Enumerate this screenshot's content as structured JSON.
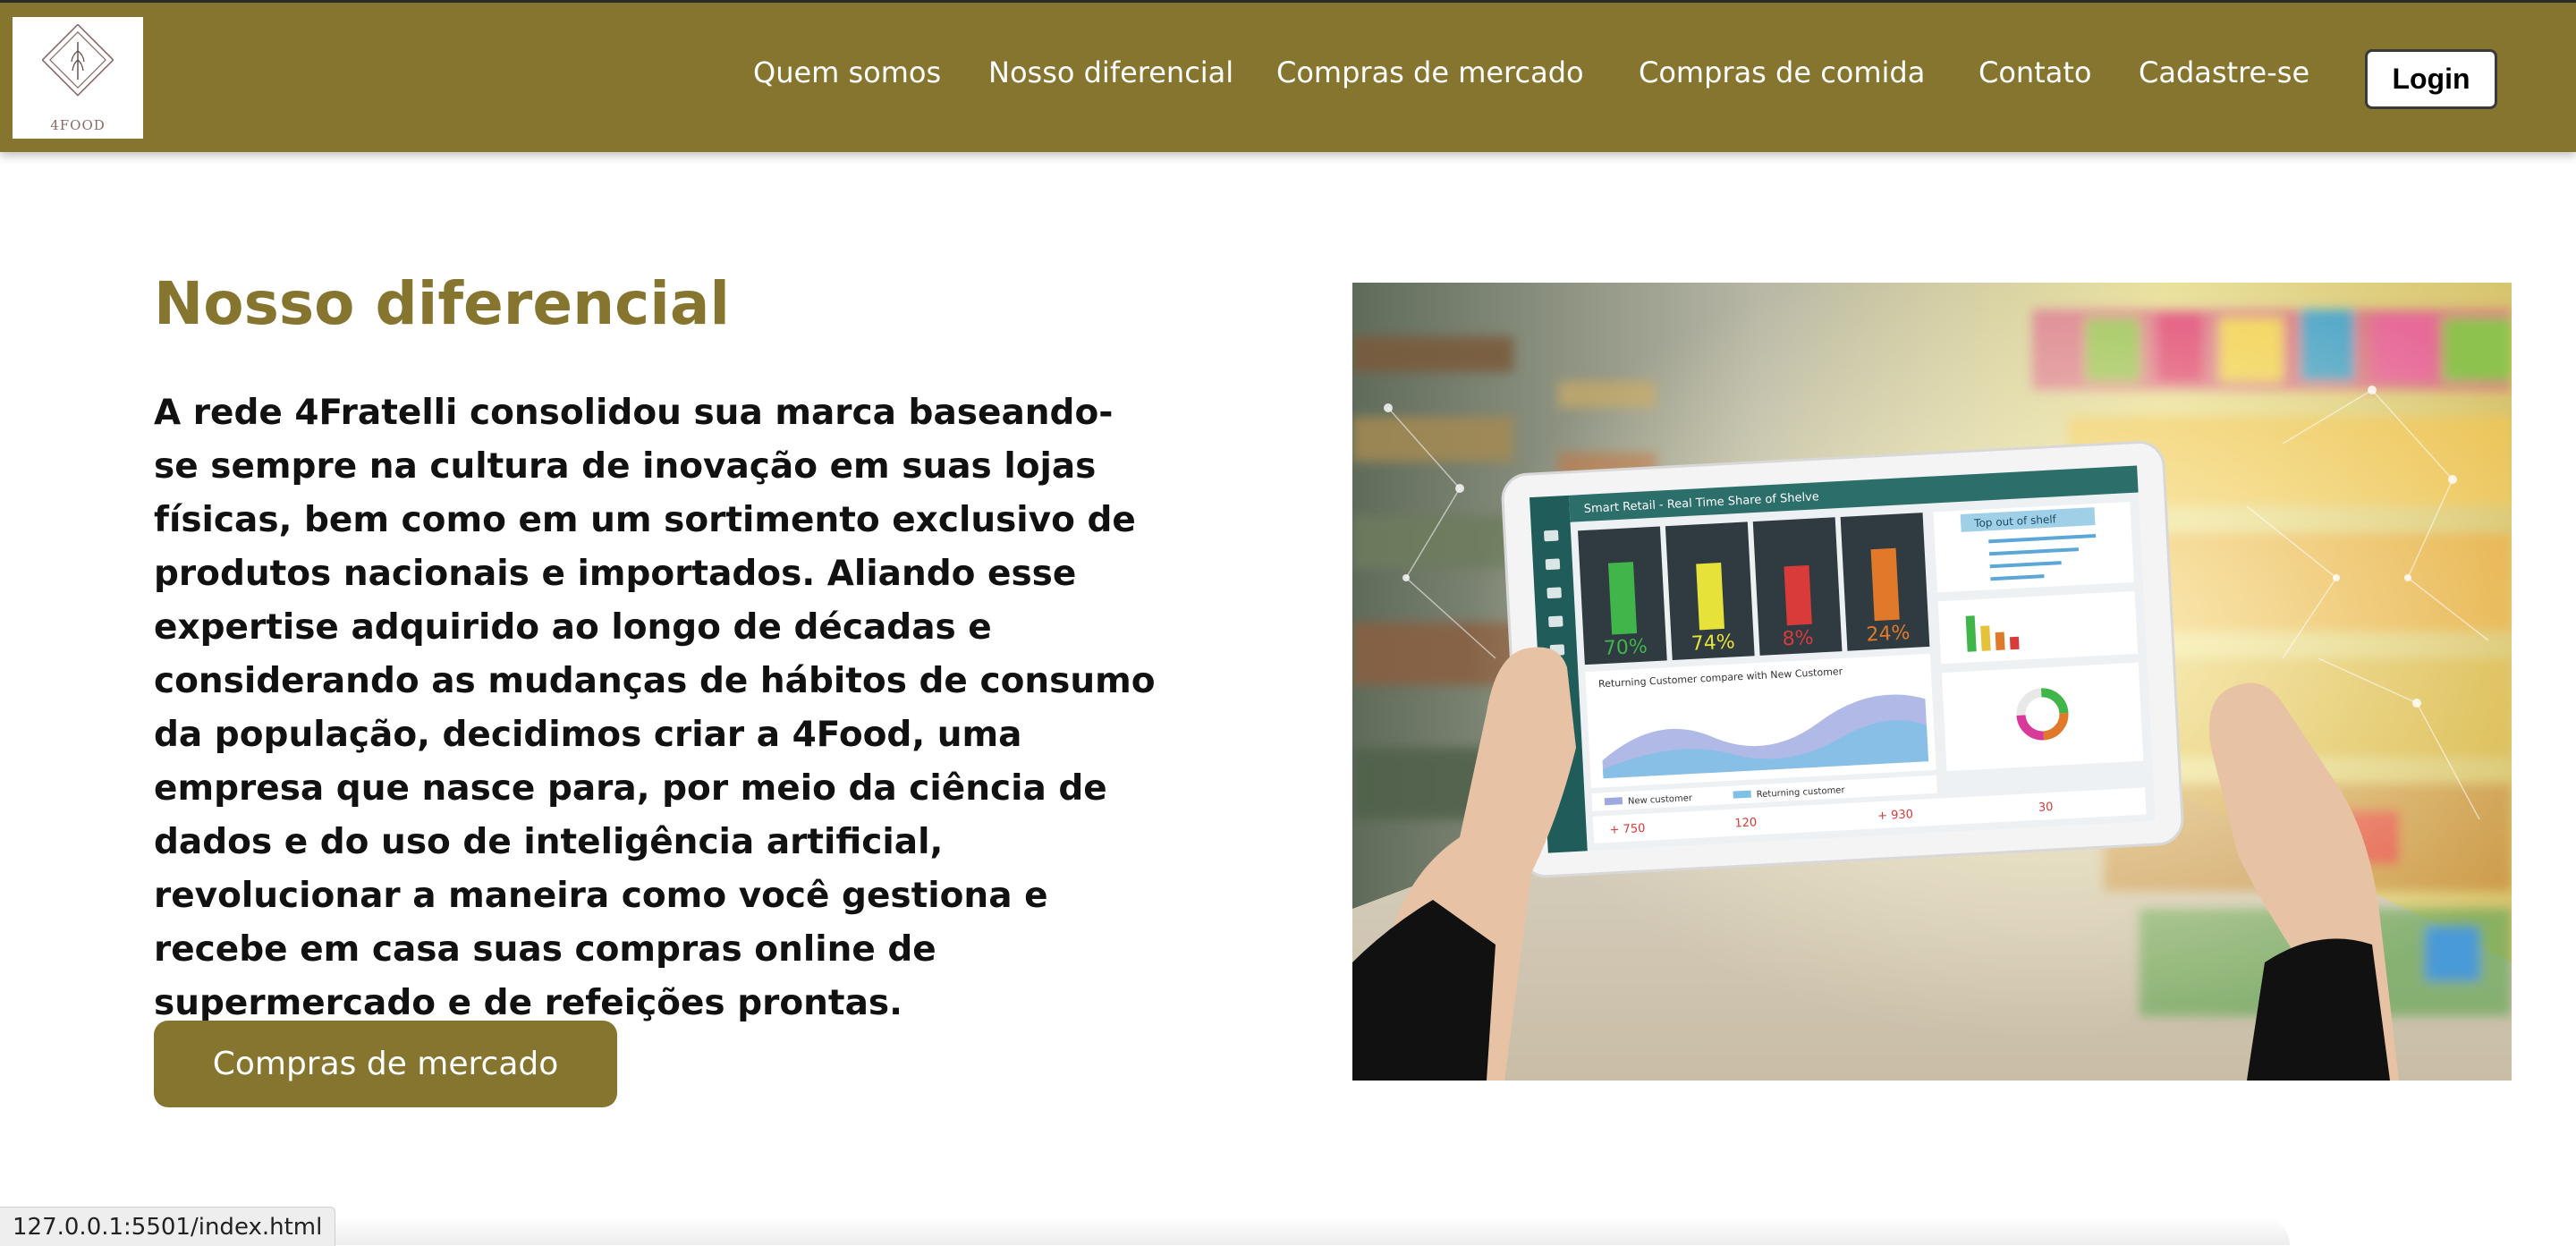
{
  "brand": {
    "logo_text": "4FOOD"
  },
  "nav": {
    "items": [
      {
        "label": "Quem somos"
      },
      {
        "label": "Nosso diferencial"
      },
      {
        "label": "Compras de mercado"
      },
      {
        "label": "Compras de comida"
      },
      {
        "label": "Contato"
      },
      {
        "label": "Cadastre-se"
      }
    ],
    "login_label": "Login"
  },
  "main": {
    "title": "Nosso diferencial",
    "paragraph": "A rede 4Fratelli consolidou sua marca baseando-se sempre na cultura de inovação em suas lojas físicas, bem como em um sortimento exclusivo de produtos nacionais e importados. Aliando esse expertise adquirido ao longo de décadas e considerando as mudanças de hábitos de consumo da população, decidimos criar a 4Food, uma empresa que nasce para, por meio da ciência de dados e do uso de inteligência artificial, revolucionar a maneira como você gestiona e recebe em casa suas compras online de supermercado e de refeições prontas.",
    "cta_label": "Compras de mercado"
  },
  "hero_image": {
    "tablet": {
      "header": "Smart Retail - Real Time Share of Shelve",
      "percents": [
        "70%",
        "74%",
        "8%",
        "24%"
      ],
      "panel_title": "Top out of shelf",
      "chart_title": "Returning Customer compare with New Customer",
      "legend": [
        "New customer",
        "Returning customer"
      ],
      "stats": [
        "+ 750",
        "120",
        "+ 930",
        "30"
      ]
    }
  },
  "status_bar": {
    "url": "127.0.0.1:5501/index.html"
  },
  "colors": {
    "brand": "#86752f",
    "text": "#111111",
    "background": "#ffffff"
  }
}
